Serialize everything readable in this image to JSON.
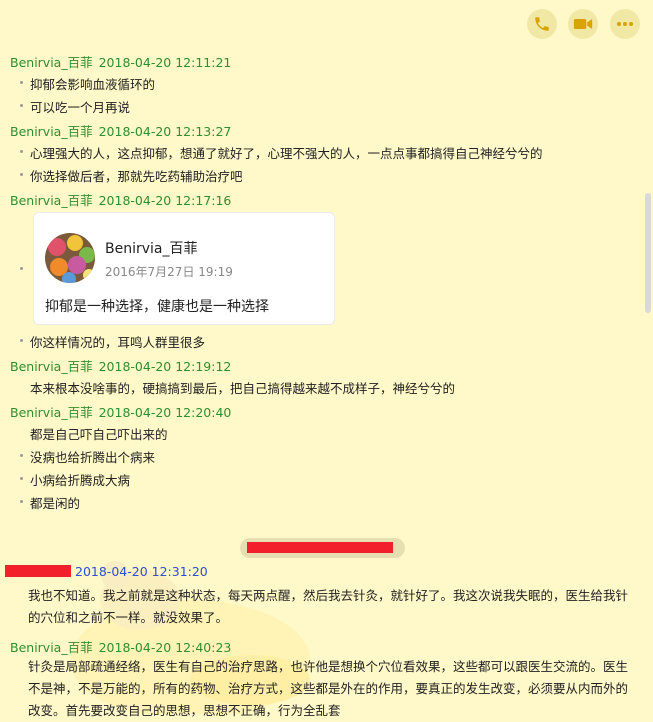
{
  "toolbar": {
    "call_icon": "phone-icon",
    "video_icon": "video-camera-icon",
    "more_icon": "more-dots-icon",
    "accent_color": "#d9a300"
  },
  "messages": [
    {
      "sender": "Benirvia_百菲",
      "time": "2018-04-20 12:11:21",
      "lines": [
        "抑郁会影响血液循环的",
        "可以吃一个月再说"
      ]
    },
    {
      "sender": "Benirvia_百菲",
      "time": "2018-04-20 12:13:27",
      "lines": [
        "心理强大的人，这点抑郁，想通了就好了，心理不强大的人，一点点事都搞得自己神经兮兮的",
        "你选择做后者，那就先吃药辅助治疗吧"
      ]
    },
    {
      "sender": "Benirvia_百菲",
      "time": "2018-04-20 12:17:16",
      "card": {
        "name": "Benirvia_百菲",
        "date": "2016年7月27日 19:19",
        "text": "抑郁是一种选择，健康也是一种选择"
      },
      "lines": [
        "你这样情况的，耳鸣人群里很多"
      ]
    },
    {
      "sender": "Benirvia_百菲",
      "time": "2018-04-20 12:19:12",
      "lines": [
        "本来根本没啥事的，硬搞搞到最后，把自己搞得越来越不成样子，神经兮兮的"
      ]
    },
    {
      "sender": "Benirvia_百菲",
      "time": "2018-04-20 12:20:40",
      "lines": [
        "都是自己吓自己吓出来的",
        "没病也给折腾出个病来",
        "小病给折腾成大病",
        "都是闲的"
      ]
    },
    {
      "sender": "",
      "time": "2018-04-20 12:31:20",
      "text": "我也不知道。我之前就是这种状态，每天两点醒，然后我去针灸，就针好了。我这次说我失眠的，医生给我针的穴位和之前不一样。就没效果了。"
    },
    {
      "sender": "Benirvia_百菲",
      "time": "2018-04-20 12:40:23",
      "text": "针灸是局部疏通经络，医生有自己的治疗思路，也许他是想换个穴位看效果，这些都可以跟医生交流的。医生不是神，不是万能的，所有的药物、治疗方式，这些都是外在的作用，要真正的发生改变，必须要从内而外的改变。首先要改变自己的思想，思想不正确，行为全乱套"
    }
  ]
}
